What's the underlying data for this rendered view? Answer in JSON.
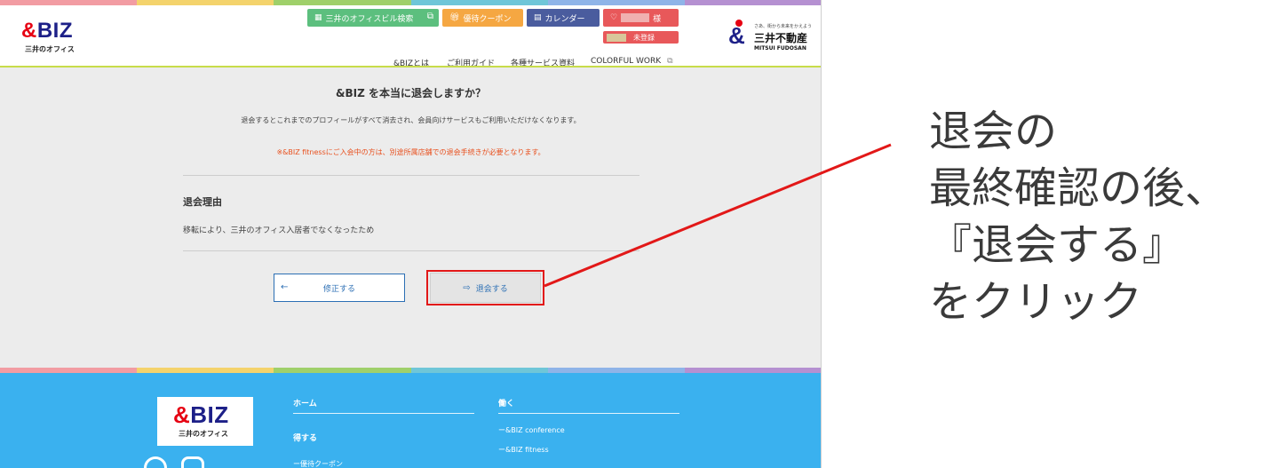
{
  "header": {
    "logo_text": "&BIZ",
    "logo_sub": "三井のオフィス",
    "buttons": {
      "office_search": "三井のオフィスビル検索",
      "coupon": "優待クーポン",
      "calendar": "カレンダー",
      "user_suffix": "様",
      "unregistered": "未登録"
    },
    "nav": [
      "&BIZとは",
      "ご利用ガイド",
      "各種サービス資料",
      "COLORFUL WORK"
    ],
    "mitsui_tagline": "さあ、街から未来をかえよう",
    "mitsui_name": "三井不動産",
    "mitsui_en": "MITSUI FUDOSAN"
  },
  "confirm": {
    "title": "&BIZ を本当に退会しますか？",
    "description": "退会するとこれまでのプロフィールがすべて消去され、会員向けサービスもご利用いただけなくなります。",
    "note": "※&BIZ fitnessにご入会中の方は、別途所属店舗での退会手続きが必要となります。",
    "reason_heading": "退会理由",
    "reason_text": "移転により、三井のオフィス入居者でなくなったため",
    "edit_button": "修正する",
    "withdraw_button": "退会する"
  },
  "footer": {
    "logo_text": "&BIZ",
    "logo_sub": "三井のオフィス",
    "col1_heading_1": "ホーム",
    "col1_heading_2": "得する",
    "col1_link": "ー優待クーポン",
    "col2_heading": "働く",
    "col2_links": [
      "ー&BIZ conference",
      "ー&BIZ fitness"
    ]
  },
  "annotation": {
    "lines": [
      "退会の",
      "最終確認の後、",
      "『退会する』",
      "をクリック"
    ]
  },
  "colors": {
    "brand_navy": "#1d2088",
    "brand_red": "#e60012",
    "footer_blue": "#3ab1ef",
    "highlight_red": "#e21818",
    "btn_green": "#5cbf7e",
    "btn_orange": "#f5a742",
    "btn_indigo": "#4a5c9e",
    "btn_red": "#e8585a"
  },
  "icons": {
    "external_link": "external-link-icon",
    "coupon": "gift-icon",
    "calendar": "calendar-icon",
    "user": "heart-user-icon",
    "back_arrow": "arrow-left-icon",
    "logout": "logout-icon"
  }
}
